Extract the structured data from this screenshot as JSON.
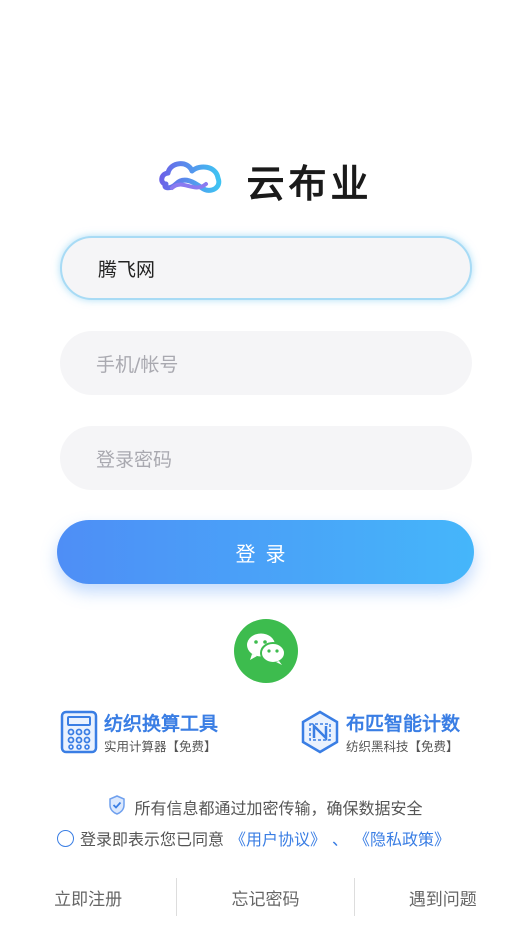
{
  "brand": {
    "title": "云布业",
    "logo_icon": "cloud-infinity-icon",
    "colors": {
      "logo_start": "#6b63e8",
      "logo_end": "#3fc3f2"
    }
  },
  "form": {
    "company_value": "腾飞网",
    "account_placeholder": "手机/帐号",
    "password_placeholder": "登录密码",
    "login_label": "登录"
  },
  "social": {
    "wechat_icon": "wechat-icon",
    "color": "#3dbc4e"
  },
  "tools": [
    {
      "icon": "calculator-icon",
      "title": "纺织换算工具",
      "subtitle": "实用计算器【免费】"
    },
    {
      "icon": "n-hexagon-icon",
      "title": "布匹智能计数",
      "subtitle": "纺织黑科技【免费】"
    }
  ],
  "notice": {
    "secure_text": "所有信息都通过加密传输，确保数据安全",
    "agree_prefix": "登录即表示您已同意",
    "user_agreement": "《用户协议》",
    "separator": "、",
    "privacy_policy": "《隐私政策》"
  },
  "footer": {
    "register": "立即注册",
    "forgot": "忘记密码",
    "help": "遇到问题"
  },
  "accent": "#3a7ee4"
}
